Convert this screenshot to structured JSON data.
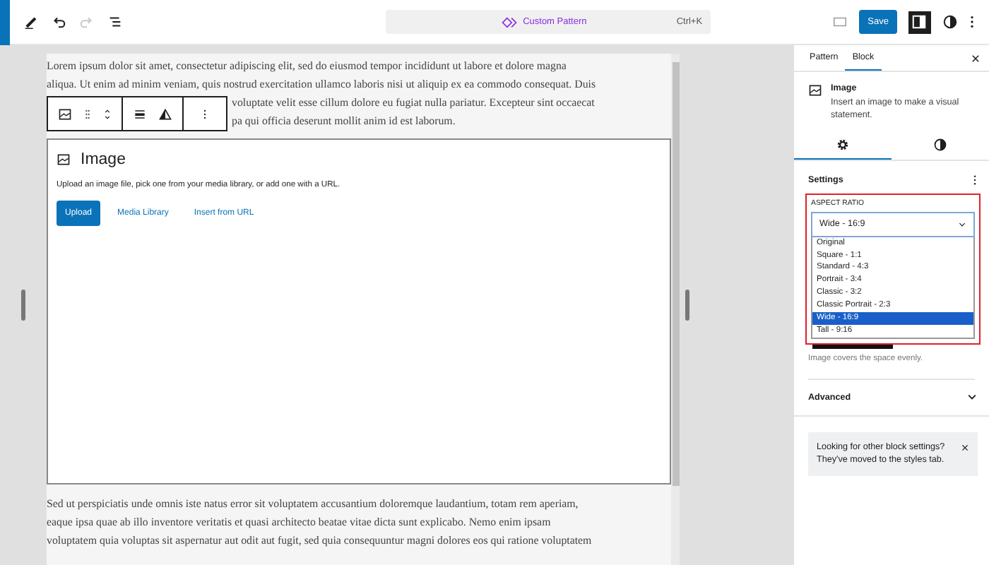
{
  "top_bar": {
    "redo_disabled": true,
    "command_bar": {
      "title": "Custom Pattern",
      "shortcut": "Ctrl+K"
    },
    "save_label": "Save",
    "sidebar_open": true
  },
  "canvas": {
    "paragraph_1": [
      "Lorem ipsum dolor sit amet, consectetur adipiscing elit, sed do eiusmod tempor incididunt ut labore et dolore magna",
      "aliqua. Ut enim ad minim veniam, quis nostrud exercitation ullamco laboris nisi ut aliquip ex ea commodo consequat. Duis"
    ],
    "paragraph_1_beside_toolbar": [
      "voluptate velit esse cillum dolore eu fugiat nulla pariatur. Excepteur sint occaecat",
      "pa qui officia deserunt mollit anim id est laborum."
    ],
    "image_block": {
      "title": "Image",
      "instructions": "Upload an image file, pick one from your media library, or add one with a URL.",
      "buttons": [
        {
          "label": "Upload",
          "kind": "primary"
        },
        {
          "label": "Media Library",
          "kind": "link"
        },
        {
          "label": "Insert from URL",
          "kind": "link"
        }
      ]
    },
    "paragraph_2": [
      "Sed ut perspiciatis unde omnis iste natus error sit voluptatem accusantium doloremque laudantium, totam rem aperiam,",
      "eaque ipsa quae ab illo inventore veritatis et quasi architecto beatae vitae dicta sunt explicabo. Nemo enim ipsam",
      "voluptatem quia voluptas sit aspernatur aut odit aut fugit, sed quia consequuntur magni dolores eos qui ratione voluptatem"
    ]
  },
  "sidebar": {
    "tabs": [
      {
        "label": "Pattern",
        "selected": false
      },
      {
        "label": "Block",
        "selected": true
      }
    ],
    "block": {
      "title": "Image",
      "description": "Insert an image to make a visual statement."
    },
    "subtabs": [
      {
        "kind": "settings",
        "selected": true
      },
      {
        "kind": "styles",
        "selected": false
      }
    ],
    "panel_title": "Settings",
    "aspect_ratio": {
      "label": "ASPECT RATIO",
      "value": "Wide - 16:9",
      "options": [
        {
          "label": "Original",
          "selected": false
        },
        {
          "label": "Square - 1:1",
          "selected": false
        },
        {
          "label": "Standard - 4:3",
          "selected": false
        },
        {
          "label": "Portrait - 3:4",
          "selected": false
        },
        {
          "label": "Classic - 3:2",
          "selected": false
        },
        {
          "label": "Classic Portrait - 2:3",
          "selected": false
        },
        {
          "label": "Wide - 16:9",
          "selected": true
        },
        {
          "label": "Tall - 9:16",
          "selected": false
        }
      ]
    },
    "help": "Image covers the space evenly.",
    "advanced": {
      "label": "Advanced",
      "expanded": false
    },
    "notice": "Looking for other block settings? They've moved to the styles tab."
  }
}
